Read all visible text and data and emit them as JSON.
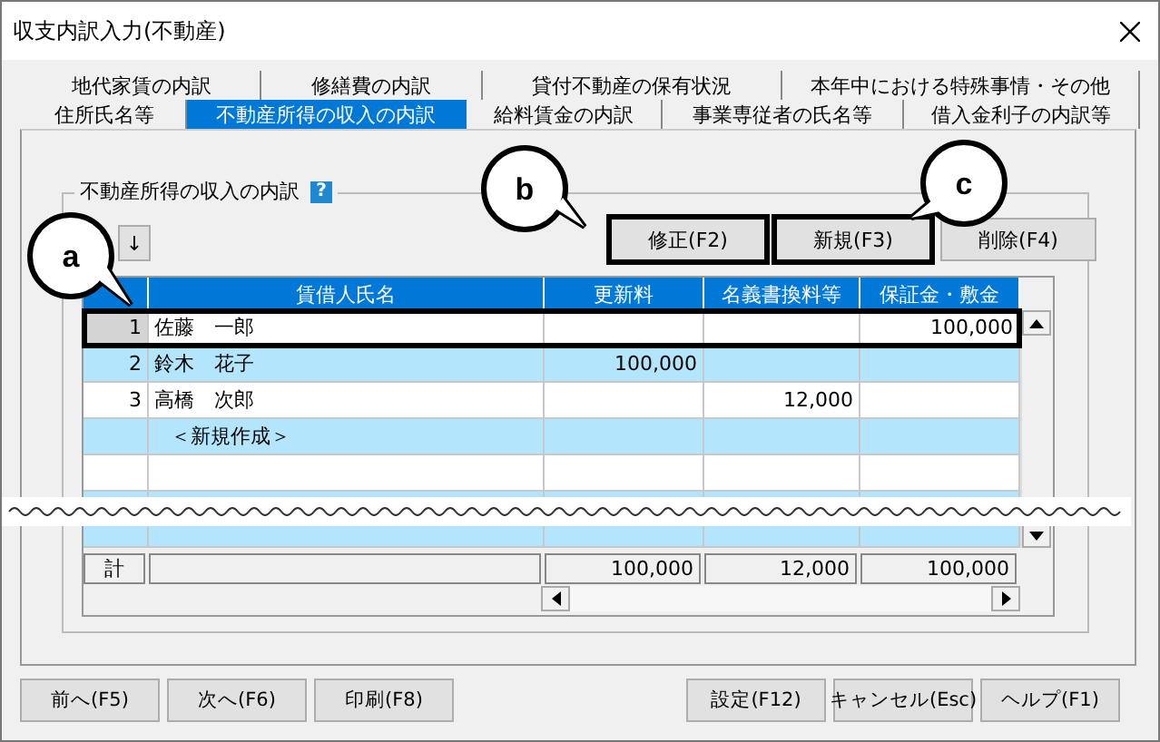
{
  "window": {
    "title": "収支内訳入力(不動産)"
  },
  "tab_rows": [
    {
      "tabs": [
        {
          "label": "地代家賃の内訳",
          "selected": false
        },
        {
          "label": "修繕費の内訳",
          "selected": false
        },
        {
          "label": "貸付不動産の保有状況",
          "selected": false
        },
        {
          "label": "本年中における特殊事情・その他",
          "selected": false
        }
      ]
    },
    {
      "tabs": [
        {
          "label": "住所氏名等",
          "selected": false
        },
        {
          "label": "不動産所得の収入の内訳",
          "selected": true
        },
        {
          "label": "給料賃金の内訳",
          "selected": false
        },
        {
          "label": "事業専従者の氏名等",
          "selected": false
        },
        {
          "label": "借入金利子の内訳等",
          "selected": false
        }
      ]
    }
  ],
  "group": {
    "title": "不動産所得の収入の内訳",
    "help": "?"
  },
  "move_button": "↓",
  "actions": [
    {
      "label": "修正(F2)",
      "highlighted": true
    },
    {
      "label": "新規(F3)",
      "highlighted": true
    },
    {
      "label": "削除(F4)",
      "highlighted": false
    }
  ],
  "table": {
    "columns": [
      {},
      {
        "label": "賃借人氏名"
      },
      {
        "label": "更新料"
      },
      {
        "label": "名義書換料等"
      },
      {
        "label": "保証金・敷金"
      }
    ],
    "rows": [
      {
        "kind": "data",
        "no": "1",
        "name": "佐藤　一郎",
        "deposit": "100,000",
        "selected": true
      },
      {
        "kind": "data",
        "no": "2",
        "name": "鈴木　花子",
        "renewal": "100,000",
        "selected": false
      },
      {
        "kind": "data",
        "no": "3",
        "name": "高橋　次郎",
        "transfer": "12,000",
        "selected": false
      },
      {
        "kind": "new",
        "name": "＜新規作成＞",
        "selected": false
      }
    ],
    "total": {
      "label": "計",
      "renewal": "100,000",
      "transfer": "12,000",
      "deposit": "100,000"
    }
  },
  "callouts": [
    "a",
    "b",
    "c"
  ],
  "footer_left": [
    "前へ(F5)",
    "次へ(F6)",
    "印刷(F8)"
  ],
  "footer_right": [
    "設定(F12)",
    "キャンセル(Esc)",
    "ヘルプ(F1)"
  ]
}
